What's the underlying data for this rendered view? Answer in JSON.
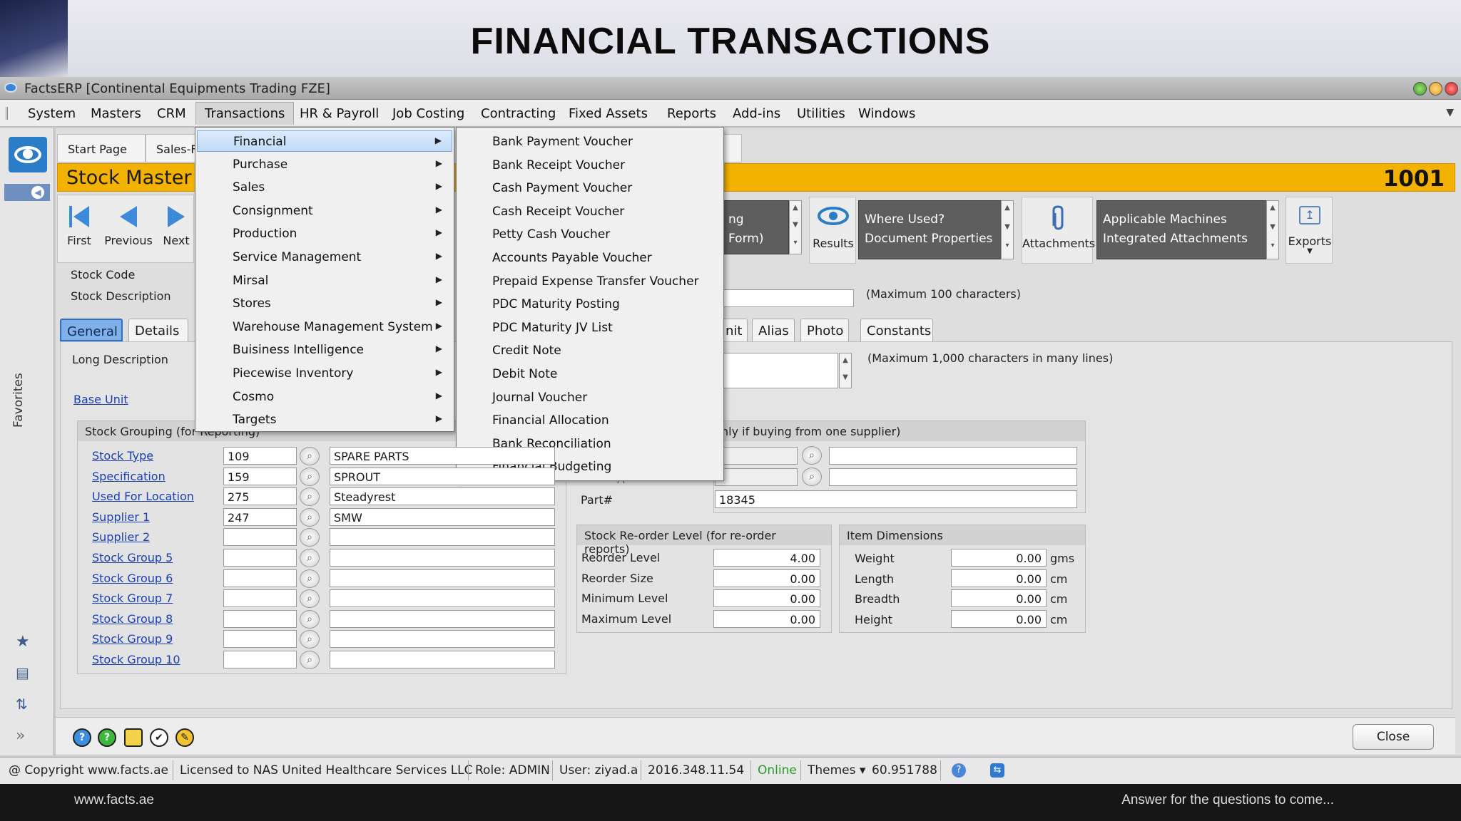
{
  "slide": {
    "title": "FINANCIAL TRANSACTIONS"
  },
  "window": {
    "title": "FactsERP [Continental Equipments Trading FZE]"
  },
  "menubar": [
    "System",
    "Masters",
    "CRM",
    "Transactions",
    "HR & Payroll",
    "Job Costing",
    "Contracting",
    "Fixed  Assets",
    "Reports",
    "Add-ins",
    "Utilities",
    "Windows"
  ],
  "transactions_menu": [
    {
      "label": "Financial",
      "active": true
    },
    {
      "label": "Purchase"
    },
    {
      "label": "Sales"
    },
    {
      "label": "Consignment"
    },
    {
      "label": "Production"
    },
    {
      "label": "Service Management"
    },
    {
      "label": "Mirsal"
    },
    {
      "label": "Stores"
    },
    {
      "label": "Warehouse Management System"
    },
    {
      "label": "Buisiness Intelligence"
    },
    {
      "label": "Piecewise Inventory"
    },
    {
      "label": "Cosmo"
    },
    {
      "label": "Targets"
    }
  ],
  "financial_submenu": [
    "Bank Payment Voucher",
    "Bank Receipt Voucher",
    "Cash Payment Voucher",
    "Cash Receipt Voucher",
    "Petty Cash Voucher",
    "Accounts Payable Voucher",
    "Prepaid Expense Transfer Voucher",
    "PDC Maturity Posting",
    "PDC Maturity JV List",
    "Credit Note",
    "Debit Note",
    "Journal Voucher",
    "Financial Allocation",
    "Bank Reconciliation",
    "Financial Budgeting"
  ],
  "side": {
    "favorites": "Favorites"
  },
  "doc_tabs": {
    "start": "Start Page",
    "sales": "Sales-F"
  },
  "header": {
    "title": "Stock Master -",
    "number": "1001"
  },
  "toolbar": {
    "first": "First",
    "previous": "Previous",
    "next": "Next",
    "form_partial": "ng Form)",
    "results": "Results",
    "where_used": "Where Used?",
    "doc_props": "Document Properties",
    "attachments": "Attachments",
    "applicable": "Applicable Machines",
    "integrated": "Integrated Attachments",
    "exports": "Exports"
  },
  "form": {
    "stock_code_label": "Stock Code",
    "stock_desc_label": "Stock Description",
    "max100": "(Maximum 100 characters)",
    "tabs": {
      "general": "General",
      "details": "Details",
      "nit": "nit",
      "alias": "Alias",
      "photo": "Photo",
      "constants": "Constants"
    },
    "long_desc_label": "Long Description",
    "max1000": "(Maximum 1,000 characters in many lines)",
    "base_unit": "Base Unit",
    "grouping_header": "Stock Grouping (for Reporting)",
    "supplier_header_partial": "nly if buying from one supplier)",
    "supplier_partial": "Supplier",
    "part_label": "Part#",
    "part_value": "18345"
  },
  "grouping": [
    {
      "label": "Stock Type",
      "code": "109",
      "desc": "SPARE PARTS"
    },
    {
      "label": "Specification",
      "code": "159",
      "desc": "SPROUT"
    },
    {
      "label": "Used For Location",
      "code": "275",
      "desc": "Steadyrest"
    },
    {
      "label": "Supplier 1",
      "code": "247",
      "desc": "SMW"
    },
    {
      "label": "Supplier 2",
      "code": "",
      "desc": ""
    },
    {
      "label": "Stock Group 5",
      "code": "",
      "desc": ""
    },
    {
      "label": "Stock Group 6",
      "code": "",
      "desc": ""
    },
    {
      "label": "Stock Group 7",
      "code": "",
      "desc": ""
    },
    {
      "label": "Stock Group 8",
      "code": "",
      "desc": ""
    },
    {
      "label": "Stock Group 9",
      "code": "",
      "desc": ""
    },
    {
      "label": "Stock Group 10",
      "code": "",
      "desc": ""
    }
  ],
  "reorder": {
    "header": "Stock Re-order Level (for re-order reports)",
    "rows": [
      {
        "label": "Reorder Level",
        "value": "4.00"
      },
      {
        "label": "Reorder Size",
        "value": "0.00"
      },
      {
        "label": "Minimum Level",
        "value": "0.00"
      },
      {
        "label": "Maximum Level",
        "value": "0.00"
      }
    ]
  },
  "dimensions": {
    "header": "Item Dimensions",
    "rows": [
      {
        "label": "Weight",
        "value": "0.00",
        "unit": "gms"
      },
      {
        "label": "Length",
        "value": "0.00",
        "unit": "cm"
      },
      {
        "label": "Breadth",
        "value": "0.00",
        "unit": "cm"
      },
      {
        "label": "Height",
        "value": "0.00",
        "unit": "cm"
      }
    ]
  },
  "buttons": {
    "close": "Close"
  },
  "status": {
    "copyright": "@ Copyright www.facts.ae",
    "licensed": "Licensed to NAS United Healthcare Services LLC",
    "role": "Role: ADMIN",
    "user": "User: ziyad.a",
    "version": "2016.348.11.54",
    "online": "Online",
    "themes": "Themes ▾",
    "number": "60.951788"
  },
  "footer": {
    "left": "www.facts.ae",
    "right": "Answer for the questions to come..."
  },
  "colors": {
    "accent_yellow": "#f3b200",
    "link_blue": "#1a3fb8",
    "online_green": "#2a9a2a",
    "menu_highlight": "#c0dbf8"
  }
}
